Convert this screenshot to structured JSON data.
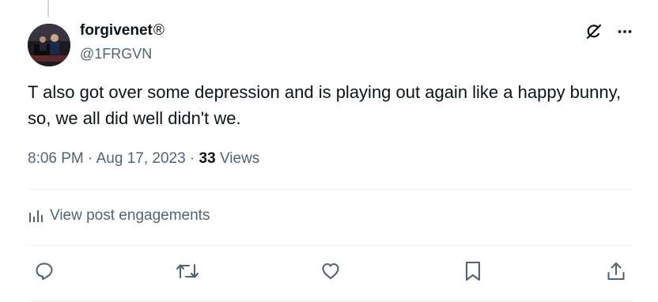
{
  "post": {
    "display_name": "forgivenet",
    "registered_mark": "®",
    "handle": "@1FRGVN",
    "text": "T also got over some depression and is playing out again like a happy bunny, so, we all did well didn't we.",
    "time": "8:06 PM",
    "separator": " · ",
    "date": "Aug 17, 2023",
    "views_count": "33",
    "views_label": " Views"
  },
  "engagements": {
    "label": "View post engagements"
  },
  "icons": {
    "grok": "grok-slash-icon",
    "more": "more-dots-icon",
    "reply": "reply-icon",
    "repost": "repost-icon",
    "like": "heart-icon",
    "bookmark": "bookmark-icon",
    "share": "share-icon",
    "analytics": "analytics-bars-icon"
  },
  "colors": {
    "text": "#0f1419",
    "secondary": "#536471",
    "divider": "#eff3f4",
    "thread_line": "#cfd9de"
  }
}
